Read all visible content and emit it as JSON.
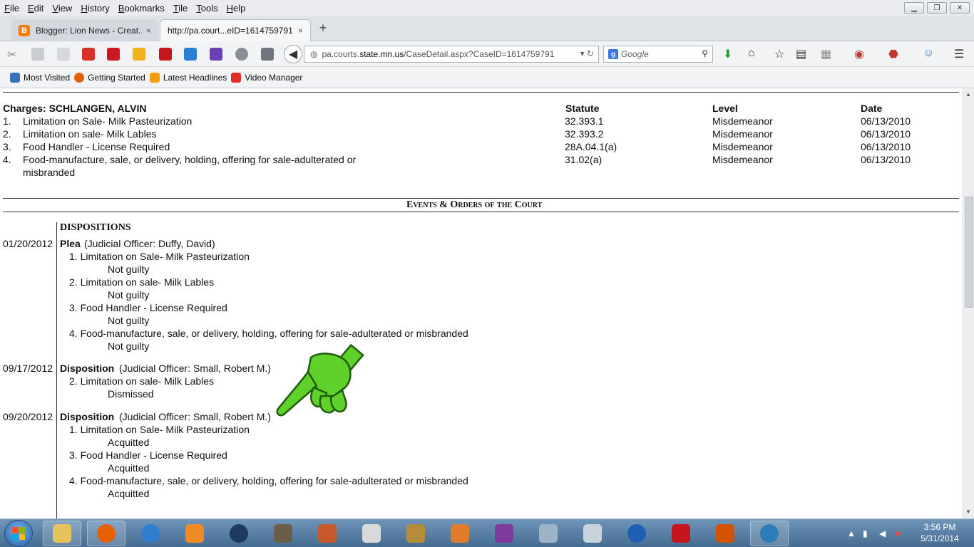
{
  "menubar": {
    "items": [
      {
        "label": "File",
        "key": "F",
        "rest": "ile"
      },
      {
        "label": "Edit",
        "key": "E",
        "rest": "dit"
      },
      {
        "label": "View",
        "key": "V",
        "rest": "iew"
      },
      {
        "label": "History",
        "key": "H",
        "rest": "istory"
      },
      {
        "label": "Bookmarks",
        "key": "B",
        "rest": "ookmarks"
      },
      {
        "label": "Tile",
        "key": "T",
        "rest": "ile"
      },
      {
        "label": "Tools",
        "key": "T",
        "rest": "ools"
      },
      {
        "label": "Help",
        "key": "H",
        "rest": "elp"
      }
    ]
  },
  "tabs": [
    {
      "title": "Blogger: Lion News - Creat...",
      "favicon": "B",
      "close": "×"
    },
    {
      "title": "http://pa.court...eID=1614759791",
      "close": "×"
    }
  ],
  "new_tab_label": "+",
  "urlbar": {
    "prefix": "pa.courts.",
    "host": "state.mn.us",
    "path": "/CaseDetail.aspx?CaseID=1614759791"
  },
  "searchbar": {
    "engine": "g",
    "placeholder": "Google"
  },
  "bookmarks": [
    {
      "label": "Most Visited",
      "icon": "most-visited-icon",
      "color": "#3a70b8"
    },
    {
      "label": "Getting Started",
      "icon": "firefox-icon",
      "color": "#e66000"
    },
    {
      "label": "Latest Headlines",
      "icon": "rss-icon",
      "color": "#f39c12"
    },
    {
      "label": "Video Manager",
      "icon": "youtube-icon",
      "color": "#e52d27"
    }
  ],
  "charges": {
    "header": "Charges: SCHLANGEN, ALVIN",
    "col_statute": "Statute",
    "col_level": "Level",
    "col_date": "Date",
    "rows": [
      {
        "num": "1.",
        "desc": "Limitation on Sale- Milk Pasteurization",
        "desc2": "",
        "statute": "32.393.1",
        "level": "Misdemeanor",
        "date": "06/13/2010"
      },
      {
        "num": "2.",
        "desc": "Limitation on sale- Milk Lables",
        "desc2": "",
        "statute": "32.393.2",
        "level": "Misdemeanor",
        "date": "06/13/2010"
      },
      {
        "num": "3.",
        "desc": "Food Handler - License Required",
        "desc2": "",
        "statute": "28A.04.1(a)",
        "level": "Misdemeanor",
        "date": "06/13/2010"
      },
      {
        "num": "4.",
        "desc": "Food-manufacture, sale, or delivery, holding, offering for sale-adulterated or",
        "desc2": "misbranded",
        "statute": "31.02(a)",
        "level": "Misdemeanor",
        "date": "06/13/2010"
      }
    ]
  },
  "events": {
    "section_title": "Events & Orders of the Court",
    "dispositions_label": "DISPOSITIONS",
    "entries": [
      {
        "date": "01/20/2012",
        "type": "Plea",
        "officer": "(Judicial Officer: Duffy, David)",
        "items": [
          {
            "charge": "1. Limitation on Sale- Milk Pasteurization",
            "result": "Not guilty"
          },
          {
            "charge": "2. Limitation on sale- Milk Lables",
            "result": "Not guilty"
          },
          {
            "charge": "3. Food Handler - License Required",
            "result": "Not guilty"
          },
          {
            "charge": "4. Food-manufacture, sale, or delivery, holding, offering for sale-adulterated or misbranded",
            "result": "Not guilty"
          }
        ]
      },
      {
        "date": "09/17/2012",
        "type": "Disposition",
        "officer": "(Judicial Officer: Small, Robert M.)",
        "items": [
          {
            "charge": "2. Limitation on sale- Milk Lables",
            "result": "Dismissed"
          }
        ]
      },
      {
        "date": "09/20/2012",
        "type": "Disposition",
        "officer": "(Judicial Officer: Small, Robert M.)",
        "items": [
          {
            "charge": "1. Limitation on Sale- Milk Pasteurization",
            "result": "Acquitted"
          },
          {
            "charge": "3. Food Handler - License Required",
            "result": "Acquitted"
          },
          {
            "charge": "4. Food-manufacture, sale, or delivery, holding, offering for sale-adulterated or misbranded",
            "result": "Acquitted"
          }
        ]
      }
    ]
  },
  "taskbar": {
    "time": "3:56 PM",
    "date": "5/31/2014"
  },
  "colors": {
    "hand_fill": "#5fd12a",
    "hand_stroke": "#1f5c0d",
    "taskbar": "#4f7599"
  }
}
